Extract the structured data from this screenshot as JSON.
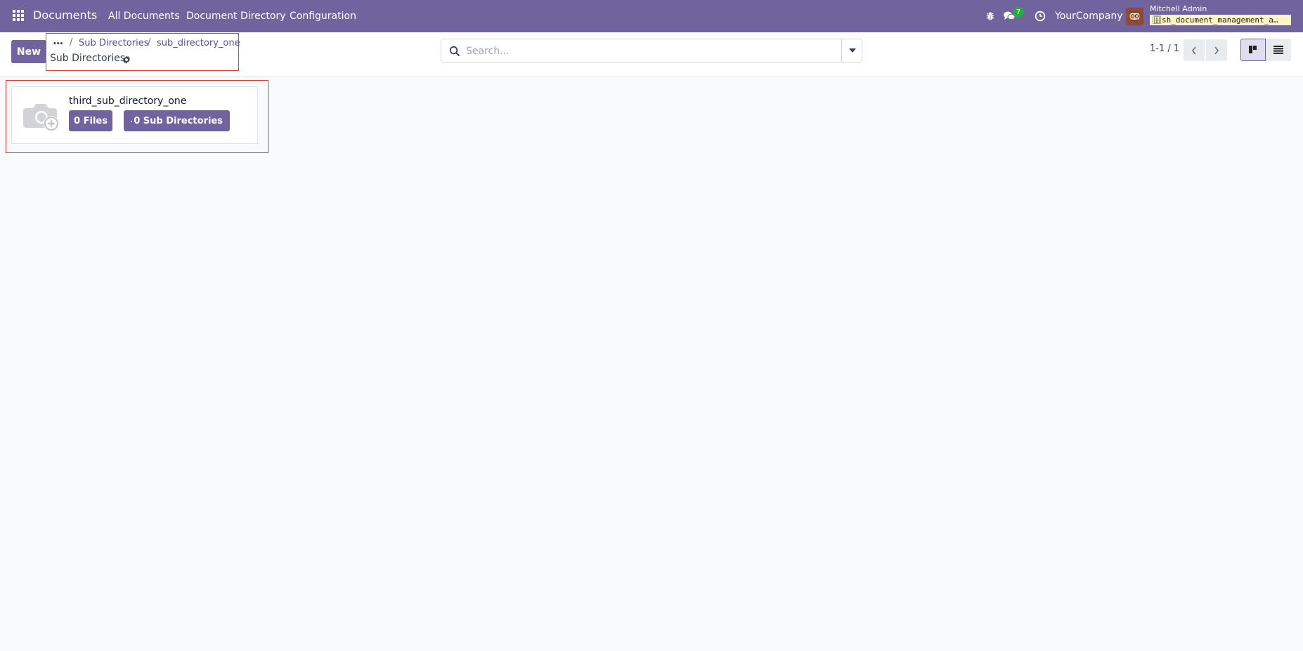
{
  "navbar": {
    "app_name": "Documents",
    "menu": [
      "All Documents",
      "Document Directory",
      "Configuration"
    ],
    "messages_count": "7",
    "company": "YourCompany",
    "user_name": "Mitchell Admin",
    "db_name": "sh_document_management_a…"
  },
  "control_panel": {
    "new_label": "New",
    "breadcrumb": {
      "ellipsis": "•••",
      "items": [
        "Sub Directories",
        "sub_directory_one"
      ],
      "separator": "/",
      "current": "Sub Directories"
    },
    "search_placeholder": "Search...",
    "pager": "1-1 / 1"
  },
  "kanban": {
    "records": [
      {
        "name": "third_sub_directory_one",
        "files_label": "0 Files",
        "subdirs_label": "0 Sub Directories"
      }
    ]
  },
  "colors": {
    "brand": "#71639e",
    "highlight": "#e53935",
    "badge": "#28a745"
  }
}
